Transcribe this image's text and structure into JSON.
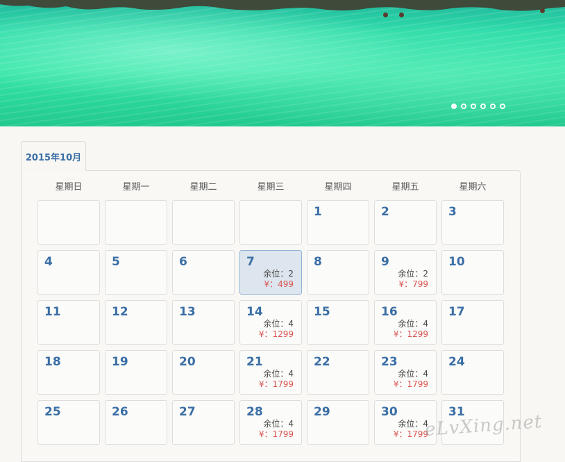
{
  "banner": {
    "image_description": "",
    "slides": [
      {
        "active": true
      },
      {
        "active": false
      },
      {
        "active": false
      },
      {
        "active": false
      },
      {
        "active": false
      },
      {
        "active": false
      }
    ]
  },
  "calendar": {
    "month_tab": "2015年10月",
    "weekdays": [
      "星期日",
      "星期一",
      "星期二",
      "星期三",
      "星期四",
      "星期五",
      "星期六"
    ],
    "selected_day": "7",
    "cells": [
      {
        "day": "",
        "seats": "",
        "price": ""
      },
      {
        "day": "",
        "seats": "",
        "price": ""
      },
      {
        "day": "",
        "seats": "",
        "price": ""
      },
      {
        "day": "",
        "seats": "",
        "price": ""
      },
      {
        "day": "1",
        "seats": "",
        "price": ""
      },
      {
        "day": "2",
        "seats": "",
        "price": ""
      },
      {
        "day": "3",
        "seats": "",
        "price": ""
      },
      {
        "day": "4",
        "seats": "",
        "price": ""
      },
      {
        "day": "5",
        "seats": "",
        "price": ""
      },
      {
        "day": "6",
        "seats": "",
        "price": ""
      },
      {
        "day": "7",
        "seats": "余位：2",
        "price": "¥：499"
      },
      {
        "day": "8",
        "seats": "",
        "price": ""
      },
      {
        "day": "9",
        "seats": "余位：2",
        "price": "¥：799"
      },
      {
        "day": "10",
        "seats": "",
        "price": ""
      },
      {
        "day": "11",
        "seats": "",
        "price": ""
      },
      {
        "day": "12",
        "seats": "",
        "price": ""
      },
      {
        "day": "13",
        "seats": "",
        "price": ""
      },
      {
        "day": "14",
        "seats": "余位：4",
        "price": "¥：1299"
      },
      {
        "day": "15",
        "seats": "",
        "price": ""
      },
      {
        "day": "16",
        "seats": "余位：4",
        "price": "¥：1299"
      },
      {
        "day": "17",
        "seats": "",
        "price": ""
      },
      {
        "day": "18",
        "seats": "",
        "price": ""
      },
      {
        "day": "19",
        "seats": "",
        "price": ""
      },
      {
        "day": "20",
        "seats": "",
        "price": ""
      },
      {
        "day": "21",
        "seats": "余位：4",
        "price": "¥：1799"
      },
      {
        "day": "22",
        "seats": "",
        "price": ""
      },
      {
        "day": "23",
        "seats": "余位：4",
        "price": "¥：1799"
      },
      {
        "day": "24",
        "seats": "",
        "price": ""
      },
      {
        "day": "25",
        "seats": "",
        "price": ""
      },
      {
        "day": "26",
        "seats": "",
        "price": ""
      },
      {
        "day": "27",
        "seats": "",
        "price": ""
      },
      {
        "day": "28",
        "seats": "余位：4",
        "price": "¥：1799"
      },
      {
        "day": "29",
        "seats": "",
        "price": ""
      },
      {
        "day": "30",
        "seats": "余位：4",
        "price": "¥：1799"
      },
      {
        "day": "31",
        "seats": "",
        "price": ""
      }
    ]
  },
  "watermark": "eLvXing.net",
  "colors": {
    "day_number": "#3a6ea5",
    "price": "#d9534f",
    "selected_bg": "#dde5ee",
    "page_bg": "#f8f7f4"
  }
}
